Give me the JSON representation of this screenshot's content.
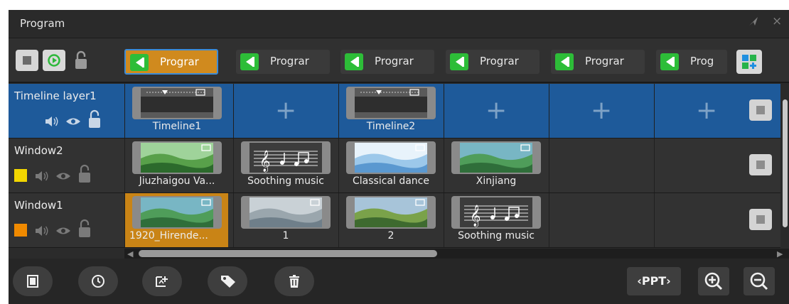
{
  "window": {
    "title": "Program",
    "pin_icon": "pin-icon",
    "close_icon": "close-icon",
    "close_glyph": "×"
  },
  "header": {
    "controls": [
      "stop-icon",
      "loop-play-icon",
      "lock-icon"
    ],
    "program_tabs": [
      "Prograr",
      "Prograr",
      "Prograr",
      "Prograr",
      "Prograr",
      "Prog"
    ],
    "active_tab_index": 0,
    "add_program_icon": "add-program-icon"
  },
  "layers": [
    {
      "name": "Timeline layer1",
      "color": "",
      "selected": true,
      "cells": [
        {
          "kind": "timeline",
          "label": "Timeline1"
        },
        {
          "kind": "add",
          "glyph": "+"
        },
        {
          "kind": "timeline",
          "label": "Timeline2"
        },
        {
          "kind": "add",
          "glyph": "+"
        },
        {
          "kind": "add",
          "glyph": "+"
        },
        {
          "kind": "add",
          "glyph": "+"
        }
      ]
    },
    {
      "name": "Window2",
      "color": "#f2d600",
      "cells": [
        {
          "kind": "image",
          "label": "Jiuzhaigou Va..."
        },
        {
          "kind": "music",
          "label": "Soothing music"
        },
        {
          "kind": "image",
          "label": "Classical dance"
        },
        {
          "kind": "image",
          "label": "Xinjiang"
        },
        {
          "kind": "empty"
        },
        {
          "kind": "empty"
        }
      ]
    },
    {
      "name": "Window1",
      "color": "#f08a00",
      "cells": [
        {
          "kind": "image",
          "label": "1920_Hirende...",
          "selected": true
        },
        {
          "kind": "image",
          "label": "1"
        },
        {
          "kind": "image",
          "label": "2"
        },
        {
          "kind": "music",
          "label": "Soothing music"
        },
        {
          "kind": "empty"
        },
        {
          "kind": "empty"
        }
      ]
    }
  ],
  "toolbar": {
    "left_tools": [
      "film-icon",
      "clock-icon",
      "add-media-icon",
      "tag-icon",
      "trash-icon"
    ],
    "ppt_label": "‹PPT›",
    "zoom_in_icon": "zoom-in-icon",
    "zoom_out_icon": "zoom-out-icon"
  }
}
